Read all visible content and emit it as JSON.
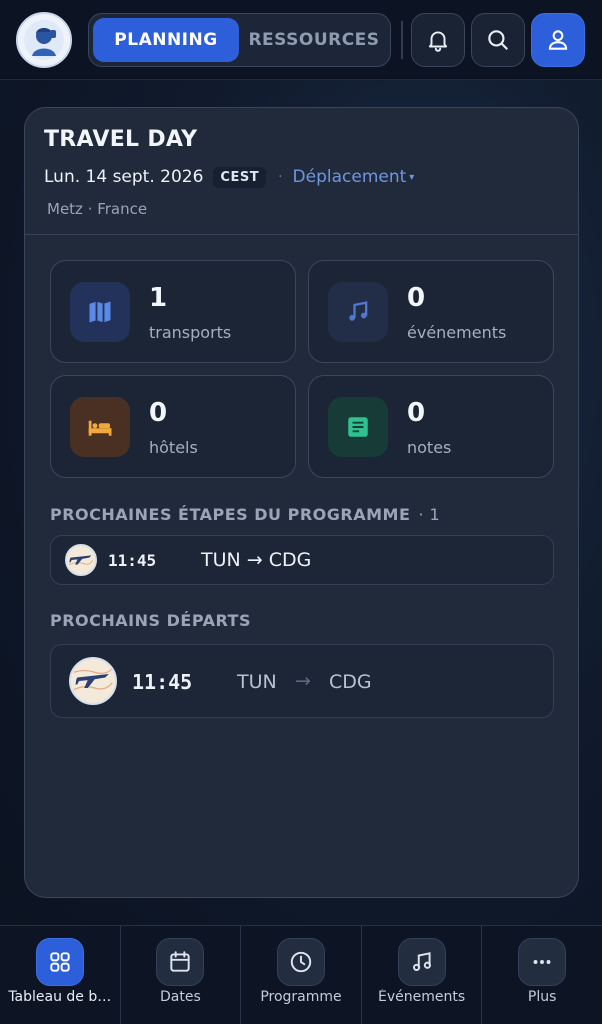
{
  "header": {
    "logo_name": "profile-logo",
    "segments": [
      {
        "label": "PLANNING",
        "active": true
      },
      {
        "label": "RESSOURCES",
        "active": false
      }
    ],
    "icons": [
      "bell-icon",
      "search-icon",
      "user-icon"
    ],
    "accent": "#2c5fd9"
  },
  "card": {
    "title": "TRAVEL DAY",
    "date": "Lun. 14 sept. 2026",
    "timezone": "CEST",
    "separator": "·",
    "type_label": "Déplacement",
    "type_caret": "▾",
    "location": "Metz · France",
    "stats": [
      {
        "value": "1",
        "label": "transports",
        "icon": "map-icon",
        "icon_bg": "#22325a",
        "icon_color": "#5b8ae6"
      },
      {
        "value": "0",
        "label": "événements",
        "icon": "music-icon",
        "icon_bg": "#222d47",
        "icon_color": "#4f78d0"
      },
      {
        "value": "0",
        "label": "hôtels",
        "icon": "bed-icon",
        "icon_bg": "#4a3023",
        "icon_color": "#f0a93a"
      },
      {
        "value": "0",
        "label": "notes",
        "icon": "note-icon",
        "icon_bg": "#173b36",
        "icon_color": "#2fc28f"
      }
    ],
    "upcoming_steps": {
      "title": "PROCHAINES ÉTAPES DU PROGRAMME",
      "count": "· 1",
      "items": [
        {
          "time": "11:45",
          "route": "TUN → CDG"
        }
      ]
    },
    "next_departures": {
      "title": "PROCHAINS DÉPARTS",
      "items": [
        {
          "time": "11:45",
          "from": "TUN",
          "arrow": "→",
          "to": "CDG"
        }
      ]
    }
  },
  "bottom_nav": [
    {
      "label": "Tableau de b…",
      "icon": "dashboard-icon",
      "active": true
    },
    {
      "label": "Dates",
      "icon": "calendar-icon",
      "active": false
    },
    {
      "label": "Programme",
      "icon": "clock-icon",
      "active": false
    },
    {
      "label": "Événements",
      "icon": "music-icon",
      "active": false
    },
    {
      "label": "Plus",
      "icon": "more-icon",
      "active": false
    }
  ]
}
